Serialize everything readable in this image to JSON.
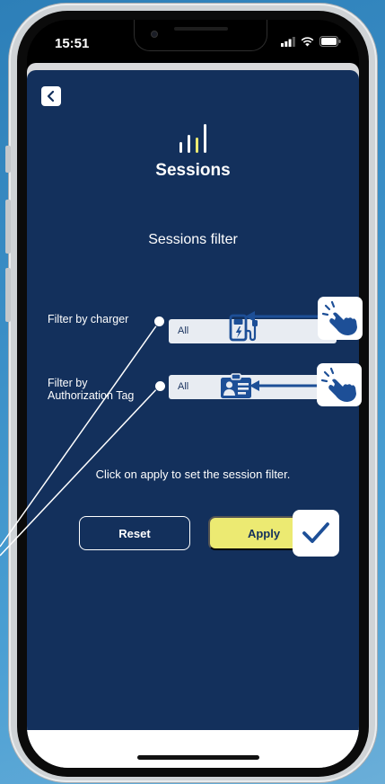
{
  "status_bar": {
    "time": "15:51"
  },
  "header": {
    "app_title": "Sessions"
  },
  "filter": {
    "title": "Sessions filter",
    "charger_label": "Filter by charger",
    "charger_value": "All",
    "auth_label_line1": "Filter by",
    "auth_label_line2": "Authorization Tag",
    "auth_value": "All"
  },
  "hint": "Click on apply to set the session filter.",
  "buttons": {
    "reset": "Reset",
    "apply": "Apply"
  },
  "icons": {
    "back": "chevron-left-icon",
    "logo": "bar-chart-icon",
    "charger": "ev-charger-icon",
    "auth": "id-card-icon",
    "tap": "tap-hand-icon",
    "check": "checkmark-icon"
  },
  "colors": {
    "app_background": "#13305c",
    "accent_yellow": "#ecea72",
    "select_background": "#e8ecf2",
    "icon_blue": "#1d4f97"
  }
}
